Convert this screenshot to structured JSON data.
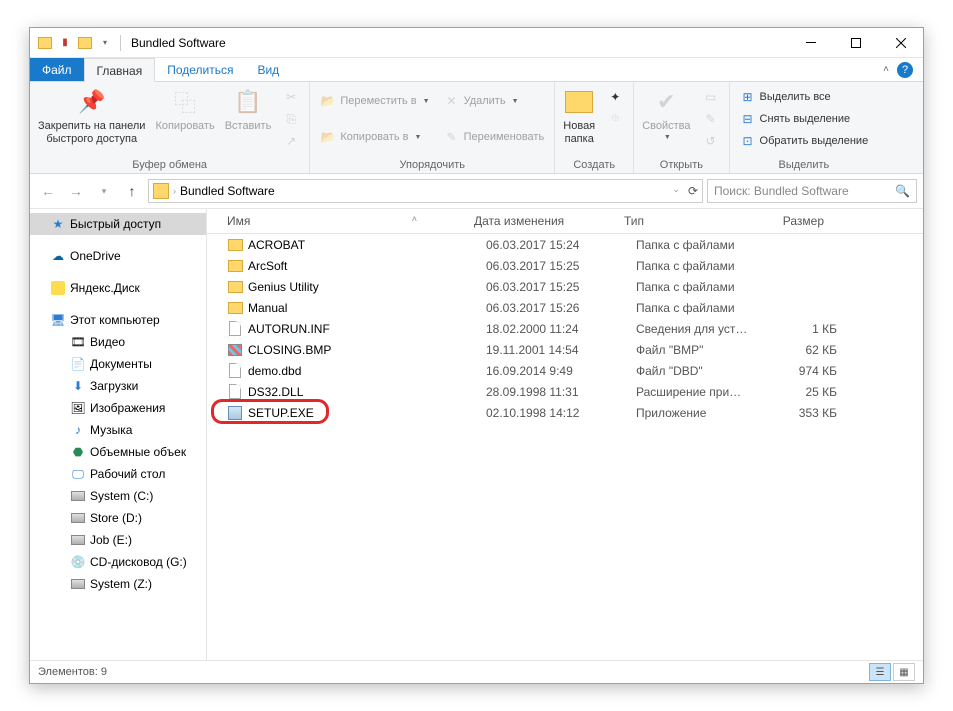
{
  "window": {
    "title": "Bundled Software"
  },
  "tabs": {
    "file": "Файл",
    "home": "Главная",
    "share": "Поделиться",
    "view": "Вид"
  },
  "ribbon": {
    "clipboard": {
      "label": "Буфер обмена",
      "pin": "Закрепить на панели\nбыстрого доступа",
      "copy": "Копировать",
      "paste": "Вставить"
    },
    "organize": {
      "label": "Упорядочить",
      "moveTo": "Переместить в",
      "copyTo": "Копировать в",
      "delete": "Удалить",
      "rename": "Переименовать"
    },
    "create": {
      "label": "Создать",
      "newFolder": "Новая\nпапка"
    },
    "open": {
      "label": "Открыть",
      "properties": "Свойства"
    },
    "select": {
      "label": "Выделить",
      "all": "Выделить все",
      "none": "Снять выделение",
      "invert": "Обратить выделение"
    }
  },
  "address": {
    "path": "Bundled Software"
  },
  "search": {
    "placeholder": "Поиск: Bundled Software"
  },
  "nav": {
    "quick": "Быстрый доступ",
    "onedrive": "OneDrive",
    "yandex": "Яндекс.Диск",
    "thispc": "Этот компьютер",
    "videos": "Видео",
    "documents": "Документы",
    "downloads": "Загрузки",
    "pictures": "Изображения",
    "music": "Музыка",
    "objects3d": "Объемные объек",
    "desktop": "Рабочий стол",
    "driveC": "System (C:)",
    "driveD": "Store (D:)",
    "driveE": "Job (E:)",
    "driveG": "CD-дисковод (G:)",
    "driveZ": "System (Z:)"
  },
  "columns": {
    "name": "Имя",
    "date": "Дата изменения",
    "type": "Тип",
    "size": "Размер"
  },
  "files": [
    {
      "name": "ACROBAT",
      "date": "06.03.2017 15:24",
      "type": "Папка с файлами",
      "size": "",
      "icon": "folder"
    },
    {
      "name": "ArcSoft",
      "date": "06.03.2017 15:25",
      "type": "Папка с файлами",
      "size": "",
      "icon": "folder"
    },
    {
      "name": "Genius Utility",
      "date": "06.03.2017 15:25",
      "type": "Папка с файлами",
      "size": "",
      "icon": "folder"
    },
    {
      "name": "Manual",
      "date": "06.03.2017 15:26",
      "type": "Папка с файлами",
      "size": "",
      "icon": "folder"
    },
    {
      "name": "AUTORUN.INF",
      "date": "18.02.2000 11:24",
      "type": "Сведения для уст…",
      "size": "1 КБ",
      "icon": "file"
    },
    {
      "name": "CLOSING.BMP",
      "date": "19.11.2001 14:54",
      "type": "Файл \"BMP\"",
      "size": "62 КБ",
      "icon": "bmp"
    },
    {
      "name": "demo.dbd",
      "date": "16.09.2014 9:49",
      "type": "Файл \"DBD\"",
      "size": "974 КБ",
      "icon": "file"
    },
    {
      "name": "DS32.DLL",
      "date": "28.09.1998 11:31",
      "type": "Расширение при…",
      "size": "25 КБ",
      "icon": "file"
    },
    {
      "name": "SETUP.EXE",
      "date": "02.10.1998 14:12",
      "type": "Приложение",
      "size": "353 КБ",
      "icon": "exe",
      "hl": true
    }
  ],
  "status": {
    "count": "Элементов: 9"
  }
}
